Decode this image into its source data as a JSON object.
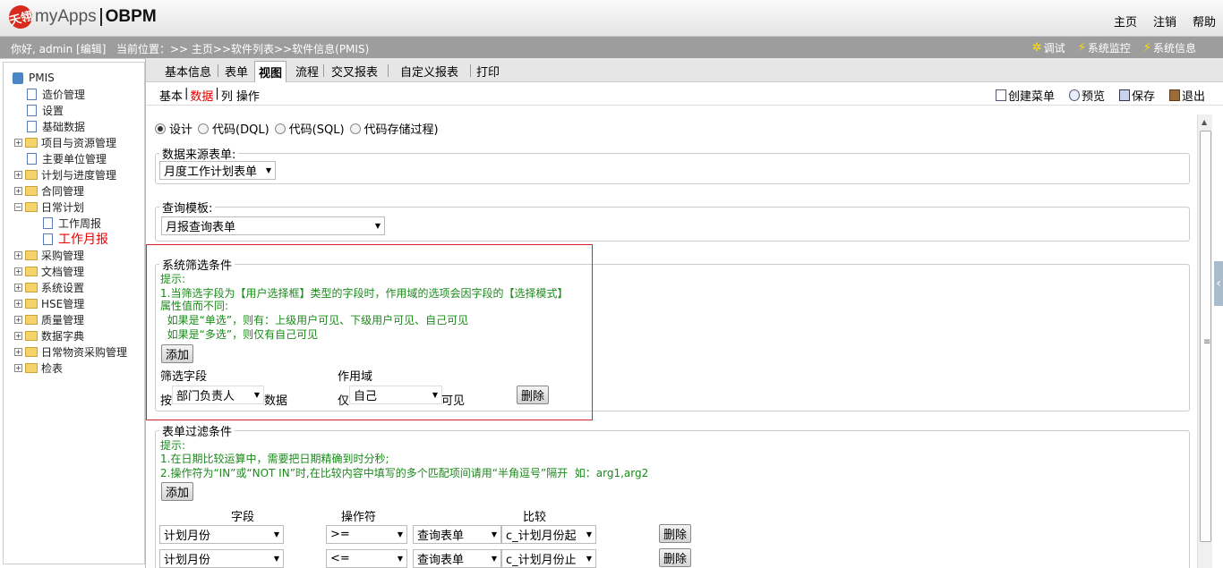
{
  "header": {
    "logo_mark": "天翎",
    "app_name": "myApps",
    "brand": "OBPM",
    "links": [
      "主页",
      "注销",
      "帮助"
    ]
  },
  "nav": {
    "greeting": "你好, admin [编辑]",
    "location": "当前位置：>> 主页>>软件列表>>软件信息(PMIS)",
    "tools": [
      "调试",
      "系统监控",
      "系统信息"
    ]
  },
  "sidebar": {
    "root": "PMIS",
    "items": [
      "造价管理",
      "设置",
      "基础数据",
      "项目与资源管理",
      "主要单位管理",
      "计划与进度管理",
      "合同管理",
      "日常计划",
      "工作周报",
      "工作月报",
      "采购管理",
      "文档管理",
      "系统设置",
      "HSE管理",
      "质量管理",
      "数据字典",
      "日常物资采购管理",
      "检表"
    ]
  },
  "tabs": [
    "基本信息",
    "表单",
    "视图",
    "流程",
    "交叉报表",
    "自定义报表",
    "打印"
  ],
  "subnav": {
    "items": [
      "基本",
      "数据",
      "列",
      "操作"
    ],
    "separator": "|"
  },
  "actions": [
    "创建菜单",
    "预览",
    "保存",
    "退出"
  ],
  "mode": {
    "options": [
      "设计",
      "代码(DQL)",
      "代码(SQL)",
      "代码存储过程)"
    ],
    "selected": 0
  },
  "datasource": {
    "legend": "数据来源表单:",
    "value": "月度工作计划表单"
  },
  "template": {
    "legend": "查询模板:",
    "value": "月报查询表单"
  },
  "system_filter": {
    "legend": "系统筛选条件",
    "hint_lines": [
      "提示:",
      "1.当筛选字段为【用户选择框】类型的字段时，作用域的选项会因字段的【选择模式】",
      "属性值而不同:",
      "  如果是“单选”，则有：上级用户可见、下级用户可见、自己可见",
      "  如果是“多选”，则仅有自己可见"
    ],
    "add_label": "添加",
    "field_header": "筛选字段",
    "scope_header": "作用域",
    "prefix": "按",
    "field_value": "部门负责人",
    "suffix": "数据",
    "scope_prefix": "仅",
    "scope_value": "自己",
    "scope_suffix": "可见",
    "delete_label": "删除"
  },
  "form_filter": {
    "legend": "表单过滤条件",
    "hint_lines": [
      "提示:",
      "1.在日期比较运算中，需要把日期精确到时分秒;",
      "2.操作符为“IN”或“NOT IN”时,在比较内容中填写的多个匹配项间请用“半角逗号”隔开  如：arg1,arg2"
    ],
    "add_label": "添加",
    "headers": [
      "字段",
      "操作符",
      "比较"
    ],
    "rows": [
      {
        "field": "计划月份",
        "op": ">=",
        "src": "查询表单",
        "cmp": "c_计划月份起",
        "delete": "删除"
      },
      {
        "field": "计划月份",
        "op": "<=",
        "src": "查询表单",
        "cmp": "c_计划月份止",
        "delete": "删除"
      }
    ]
  },
  "colors": {
    "accent": "#d3262b",
    "hint": "#1a8a1a",
    "navbar": "#9d9d9d"
  }
}
